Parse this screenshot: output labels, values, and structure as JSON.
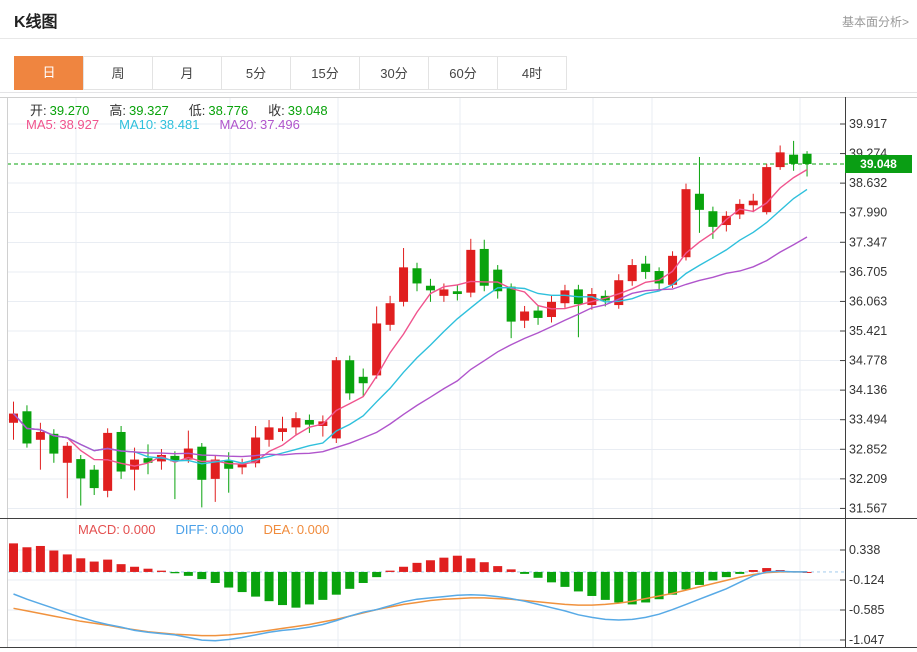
{
  "header": {
    "title": "K线图",
    "link_label": "基本面分析>"
  },
  "tabs": {
    "items": [
      {
        "key": "day",
        "label": "日",
        "active": true
      },
      {
        "key": "week",
        "label": "周",
        "active": false
      },
      {
        "key": "month",
        "label": "月",
        "active": false
      },
      {
        "key": "5min",
        "label": "5分",
        "active": false
      },
      {
        "key": "15min",
        "label": "15分",
        "active": false
      },
      {
        "key": "30min",
        "label": "30分",
        "active": false
      },
      {
        "key": "60min",
        "label": "60分",
        "active": false
      },
      {
        "key": "4hour",
        "label": "4时",
        "active": false
      }
    ]
  },
  "colors": {
    "accent_orange": "#ef8540",
    "up": "#e01f1f",
    "down": "#09a30d",
    "ma5": "#f0548e",
    "ma10": "#2fc0dc",
    "ma20": "#b055cc",
    "diff_line": "#58aae6",
    "dea_line": "#f0923e",
    "price_line": "#09a30d",
    "badge_bg": "#0a9e14",
    "ohlc_value": "#08a20a",
    "macd_label": "#e45050",
    "diff_label": "#4aa0e8",
    "dea_label": "#f08b3c",
    "grid": "#e9edf3",
    "zero_dash": "#bcd9f2",
    "axis_dark": "#3f3f3f",
    "frame_light": "#d0d0d0",
    "axis_text": "#333333"
  },
  "ohlc_legend": {
    "items": [
      {
        "label": "开:",
        "value": "39.270"
      },
      {
        "label": "高:",
        "value": "39.327"
      },
      {
        "label": "低:",
        "value": "38.776"
      },
      {
        "label": "收:",
        "value": "39.048"
      }
    ]
  },
  "ma_legend": {
    "items": [
      {
        "label": "MA5:",
        "value": "38.927",
        "color_key": "ma5"
      },
      {
        "label": "MA10:",
        "value": "38.481",
        "color_key": "ma10"
      },
      {
        "label": "MA20:",
        "value": "37.496",
        "color_key": "ma20"
      }
    ]
  },
  "macd_legend": {
    "items": [
      {
        "label": "MACD:",
        "value": "0.000",
        "color_key": "macd_label"
      },
      {
        "label": "DIFF:",
        "value": "0.000",
        "color_key": "diff_label"
      },
      {
        "label": "DEA:",
        "value": "0.000",
        "color_key": "dea_label"
      }
    ]
  },
  "chart_data": {
    "type": "candlestick",
    "title": "K线图",
    "interval_selected": "日",
    "current_price": 39.048,
    "current_price_label": "39.048",
    "open": 39.27,
    "high": 39.327,
    "low": 38.776,
    "close": 39.048,
    "ma5": 38.927,
    "ma10": 38.481,
    "ma20": 37.496,
    "macd": 0.0,
    "diff_value": 0.0,
    "dea_value": 0.0,
    "y_ticks": [
      39.917,
      39.274,
      38.632,
      37.99,
      37.347,
      36.705,
      36.063,
      35.421,
      34.778,
      34.136,
      33.494,
      32.852,
      32.209,
      31.567
    ],
    "macd_y_ticks": [
      0.338,
      -0.124,
      -0.585,
      -1.047
    ],
    "x_gridlines": [
      76,
      230,
      338,
      460,
      593,
      652,
      800
    ],
    "candles_ohlc": [
      [
        33.42,
        33.88,
        33.05,
        33.62
      ],
      [
        33.67,
        33.8,
        32.88,
        32.97
      ],
      [
        33.05,
        33.42,
        32.4,
        33.22
      ],
      [
        33.18,
        33.28,
        32.55,
        32.75
      ],
      [
        32.55,
        33.0,
        31.78,
        32.92
      ],
      [
        32.63,
        32.72,
        31.62,
        32.21
      ],
      [
        32.4,
        32.5,
        31.85,
        32.0
      ],
      [
        31.94,
        33.3,
        31.8,
        33.2
      ],
      [
        33.22,
        33.35,
        32.2,
        32.36
      ],
      [
        32.4,
        32.88,
        31.95,
        32.62
      ],
      [
        32.65,
        32.95,
        32.3,
        32.55
      ],
      [
        32.58,
        32.85,
        32.4,
        32.72
      ],
      [
        32.7,
        32.8,
        31.76,
        32.58
      ],
      [
        32.62,
        33.25,
        32.55,
        32.86
      ],
      [
        32.9,
        32.98,
        31.58,
        32.18
      ],
      [
        32.2,
        32.7,
        31.7,
        32.62
      ],
      [
        32.6,
        32.78,
        31.9,
        32.42
      ],
      [
        32.45,
        32.64,
        32.3,
        32.52
      ],
      [
        32.54,
        33.35,
        32.45,
        33.1
      ],
      [
        33.05,
        33.48,
        32.9,
        33.32
      ],
      [
        33.22,
        33.55,
        33.02,
        33.3
      ],
      [
        33.32,
        33.65,
        33.15,
        33.52
      ],
      [
        33.48,
        33.6,
        33.2,
        33.38
      ],
      [
        33.35,
        33.58,
        33.12,
        33.45
      ],
      [
        33.08,
        34.85,
        32.98,
        34.78
      ],
      [
        34.78,
        34.88,
        33.92,
        34.06
      ],
      [
        34.42,
        34.6,
        33.98,
        34.28
      ],
      [
        34.45,
        35.95,
        34.38,
        35.58
      ],
      [
        35.55,
        36.18,
        35.42,
        36.02
      ],
      [
        36.05,
        37.22,
        35.95,
        36.8
      ],
      [
        36.78,
        36.9,
        36.28,
        36.45
      ],
      [
        36.4,
        36.55,
        36.05,
        36.3
      ],
      [
        36.18,
        36.45,
        36.05,
        36.32
      ],
      [
        36.28,
        36.42,
        36.08,
        36.22
      ],
      [
        36.25,
        37.42,
        36.15,
        37.18
      ],
      [
        37.2,
        37.4,
        36.28,
        36.4
      ],
      [
        36.75,
        36.85,
        36.12,
        36.28
      ],
      [
        36.38,
        36.45,
        35.26,
        35.62
      ],
      [
        35.64,
        35.96,
        35.48,
        35.84
      ],
      [
        35.86,
        35.98,
        35.55,
        35.7
      ],
      [
        35.72,
        36.18,
        35.6,
        36.05
      ],
      [
        36.02,
        36.42,
        35.92,
        36.3
      ],
      [
        36.32,
        36.42,
        35.28,
        36.0
      ],
      [
        35.98,
        36.35,
        35.88,
        36.22
      ],
      [
        36.18,
        36.3,
        35.95,
        36.08
      ],
      [
        35.98,
        36.65,
        35.9,
        36.52
      ],
      [
        36.5,
        36.98,
        36.4,
        36.85
      ],
      [
        36.88,
        37.05,
        36.55,
        36.7
      ],
      [
        36.72,
        36.8,
        36.32,
        36.45
      ],
      [
        36.42,
        37.15,
        36.35,
        37.05
      ],
      [
        37.02,
        38.62,
        36.95,
        38.5
      ],
      [
        38.4,
        39.2,
        37.55,
        38.05
      ],
      [
        38.02,
        38.12,
        37.42,
        37.68
      ],
      [
        37.72,
        38.02,
        37.58,
        37.92
      ],
      [
        37.95,
        38.28,
        37.85,
        38.18
      ],
      [
        38.15,
        38.4,
        38.0,
        38.25
      ],
      [
        38.0,
        39.05,
        37.95,
        38.98
      ],
      [
        38.98,
        39.45,
        38.92,
        39.3
      ],
      [
        39.25,
        39.55,
        38.9,
        39.05
      ],
      [
        39.27,
        39.327,
        38.776,
        39.048
      ]
    ],
    "ma_windows": [
      5,
      10,
      20
    ],
    "macd_hist": [
      0.44,
      0.38,
      0.4,
      0.33,
      0.27,
      0.21,
      0.16,
      0.19,
      0.12,
      0.08,
      0.05,
      0.02,
      -0.02,
      -0.06,
      -0.11,
      -0.17,
      -0.24,
      -0.31,
      -0.38,
      -0.45,
      -0.51,
      -0.55,
      -0.5,
      -0.43,
      -0.35,
      -0.26,
      -0.17,
      -0.08,
      0.02,
      0.08,
      0.14,
      0.18,
      0.22,
      0.25,
      0.21,
      0.15,
      0.09,
      0.04,
      -0.03,
      -0.09,
      -0.16,
      -0.23,
      -0.3,
      -0.37,
      -0.43,
      -0.47,
      -0.5,
      -0.47,
      -0.42,
      -0.35,
      -0.27,
      -0.2,
      -0.13,
      -0.08,
      -0.03,
      0.03,
      0.06,
      0.03,
      0.01,
      0.0
    ],
    "macd_diff": [
      -0.34,
      -0.42,
      -0.49,
      -0.56,
      -0.63,
      -0.7,
      -0.76,
      -0.81,
      -0.85,
      -0.9,
      -0.93,
      -0.95,
      -0.97,
      -1.01,
      -1.05,
      -1.06,
      -1.04,
      -1.01,
      -0.97,
      -0.93,
      -0.9,
      -0.88,
      -0.85,
      -0.81,
      -0.75,
      -0.68,
      -0.62,
      -0.58,
      -0.52,
      -0.46,
      -0.42,
      -0.4,
      -0.38,
      -0.36,
      -0.35,
      -0.36,
      -0.38,
      -0.41,
      -0.45,
      -0.5,
      -0.55,
      -0.6,
      -0.66,
      -0.7,
      -0.73,
      -0.74,
      -0.73,
      -0.7,
      -0.65,
      -0.58,
      -0.5,
      -0.42,
      -0.34,
      -0.26,
      -0.16,
      -0.06,
      0.0,
      0.01,
      0.0,
      0.0
    ],
    "macd_dea": [
      -0.56,
      -0.6,
      -0.64,
      -0.68,
      -0.72,
      -0.76,
      -0.79,
      -0.82,
      -0.86,
      -0.89,
      -0.92,
      -0.94,
      -0.96,
      -0.97,
      -0.98,
      -0.98,
      -0.97,
      -0.95,
      -0.93,
      -0.9,
      -0.87,
      -0.84,
      -0.81,
      -0.77,
      -0.73,
      -0.68,
      -0.63,
      -0.58,
      -0.54,
      -0.5,
      -0.47,
      -0.44,
      -0.42,
      -0.41,
      -0.4,
      -0.4,
      -0.41,
      -0.42,
      -0.44,
      -0.46,
      -0.48,
      -0.5,
      -0.51,
      -0.51,
      -0.5,
      -0.48,
      -0.45,
      -0.41,
      -0.37,
      -0.33,
      -0.28,
      -0.23,
      -0.18,
      -0.13,
      -0.08,
      -0.04,
      -0.01,
      0.0,
      0.0,
      0.0
    ]
  }
}
